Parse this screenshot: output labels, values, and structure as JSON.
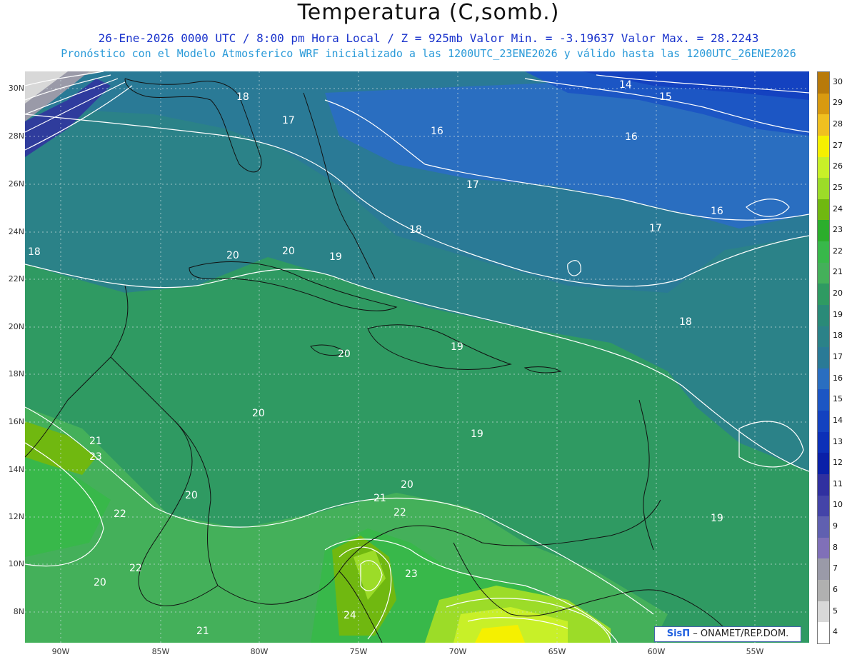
{
  "header": {
    "title": "Temperatura (C,somb.)",
    "subtitle1": "26-Ene-2026  0000 UTC / 8:00 pm Hora Local / Z = 925mb   Valor Min. = -3.19637  Valor Max. = 28.2243",
    "subtitle2": "Pronóstico con el Modelo Atmosferico WRF inicializado a las 1200UTC_23ENE2026 y válido hasta las  1200UTC_26ENE2026"
  },
  "axes": {
    "lat_labels": [
      "30N",
      "28N",
      "26N",
      "24N",
      "22N",
      "20N",
      "18N",
      "16N",
      "14N",
      "12N",
      "10N",
      "8N"
    ],
    "lon_labels": [
      "90W",
      "85W",
      "80W",
      "75W",
      "70W",
      "65W",
      "60W",
      "55W"
    ]
  },
  "colorbar": {
    "labels": [
      "30",
      "29",
      "28",
      "27",
      "26",
      "25",
      "24",
      "23",
      "22",
      "21",
      "20",
      "19",
      "18",
      "17",
      "16",
      "15",
      "14",
      "13",
      "12",
      "11",
      "10",
      "9",
      "8",
      "7",
      "6",
      "5",
      "4"
    ],
    "colors": [
      "#b87a0a",
      "#d89a10",
      "#f0c020",
      "#f5f000",
      "#c8f028",
      "#9cdc28",
      "#70b810",
      "#2cae2c",
      "#38b84a",
      "#44b05a",
      "#2f9a62",
      "#2a8a78",
      "#2b8288",
      "#2a7a96",
      "#2a6ec0",
      "#1c56c4",
      "#1442c0",
      "#0c30b8",
      "#0a20a8",
      "#3030a0",
      "#4444a8",
      "#6060b0",
      "#8070b8",
      "#9a9aa8",
      "#b0b0b0",
      "#d8d8d8",
      "#ffffff"
    ]
  },
  "contour_labels": [
    "14",
    "15",
    "16",
    "16",
    "16",
    "17",
    "17",
    "17",
    "18",
    "18",
    "18",
    "18",
    "19",
    "19",
    "19",
    "19",
    "20",
    "20",
    "20",
    "20",
    "20",
    "20",
    "20",
    "21",
    "21",
    "21",
    "22",
    "22",
    "22",
    "23",
    "23",
    "24"
  ],
  "credit": {
    "brand": "SisΠ",
    "text": " – ONAMET/REP.DOM."
  }
}
